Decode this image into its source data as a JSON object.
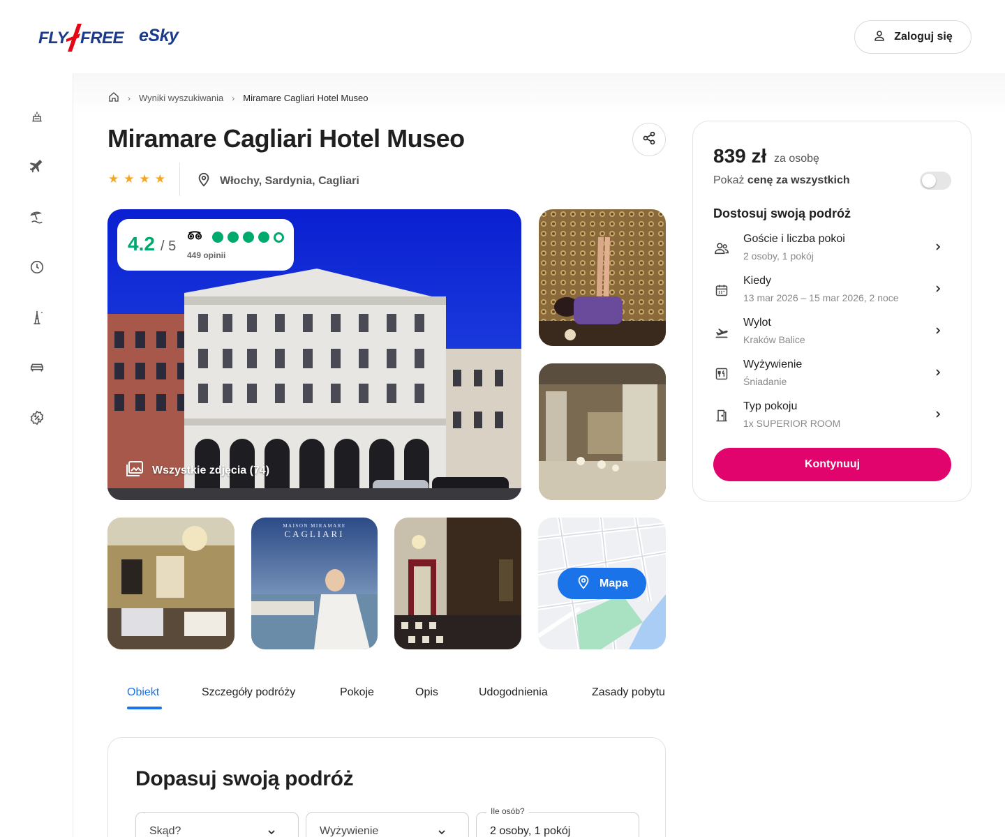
{
  "header": {
    "logo_fly": "FLY",
    "logo_free": "FREE",
    "logo_esky": "eSky",
    "login_label": "Zaloguj się"
  },
  "rail": {
    "icons": [
      "holiday-icon",
      "flight-icon",
      "beach-icon",
      "last-minute-icon",
      "city-break-icon",
      "car-icon",
      "deals-icon"
    ]
  },
  "breadcrumb": {
    "results": "Wyniki wyszukiwania",
    "current": "Miramare Cagliari Hotel Museo"
  },
  "hotel": {
    "name": "Miramare Cagliari Hotel Museo",
    "stars": 4,
    "location": "Włochy, Sardynia, Cagliari"
  },
  "rating": {
    "score": "4.2",
    "of": "/ 5",
    "reviews": "449 opinii",
    "bubbles_filled": 4,
    "bubbles_total": 5,
    "color": "#00aa6c"
  },
  "gallery": {
    "all_photos": "Wszystkie zdjęcia (74)",
    "thumb2_caption_top": "MAISON MIRAMARE",
    "thumb2_caption": "CAGLIARI",
    "map_label": "Mapa"
  },
  "tabs": [
    {
      "label": "Obiekt",
      "active": true
    },
    {
      "label": "Szczegóły podróży"
    },
    {
      "label": "Pokoje"
    },
    {
      "label": "Opis"
    },
    {
      "label": "Udogodnienia"
    },
    {
      "label": "Zasady pobytu"
    }
  ],
  "fit": {
    "title": "Dopasuj swoją podróż",
    "from": "Skąd?",
    "board": "Wyżywienie",
    "guests_label": "Ile osób?",
    "guests_value": "2 osoby, 1 pokój"
  },
  "booking": {
    "price": "839 zł",
    "per": "za osobę",
    "show_all_prefix": "Pokaż",
    "show_all_bold": "cenę za wszystkich",
    "heading": "Dostosuj swoją podróż",
    "options": [
      {
        "title": "Goście i liczba pokoi",
        "sub": "2 osoby, 1 pokój",
        "icon": "guests-icon"
      },
      {
        "title": "Kiedy",
        "sub": "13 mar 2026 – 15 mar 2026, 2 noce",
        "icon": "calendar-icon"
      },
      {
        "title": "Wylot",
        "sub": "Kraków Balice",
        "icon": "departure-icon"
      },
      {
        "title": "Wyżywienie",
        "sub": "Śniadanie",
        "icon": "board-icon"
      },
      {
        "title": "Typ pokoju",
        "sub": "1x SUPERIOR ROOM",
        "icon": "room-icon"
      }
    ],
    "continue_label": "Kontynuuj",
    "accent": "#e2046d"
  },
  "colors": {
    "brand_blue": "#1b3a8c",
    "link_blue": "#1a73e8",
    "star": "#f5a623"
  }
}
